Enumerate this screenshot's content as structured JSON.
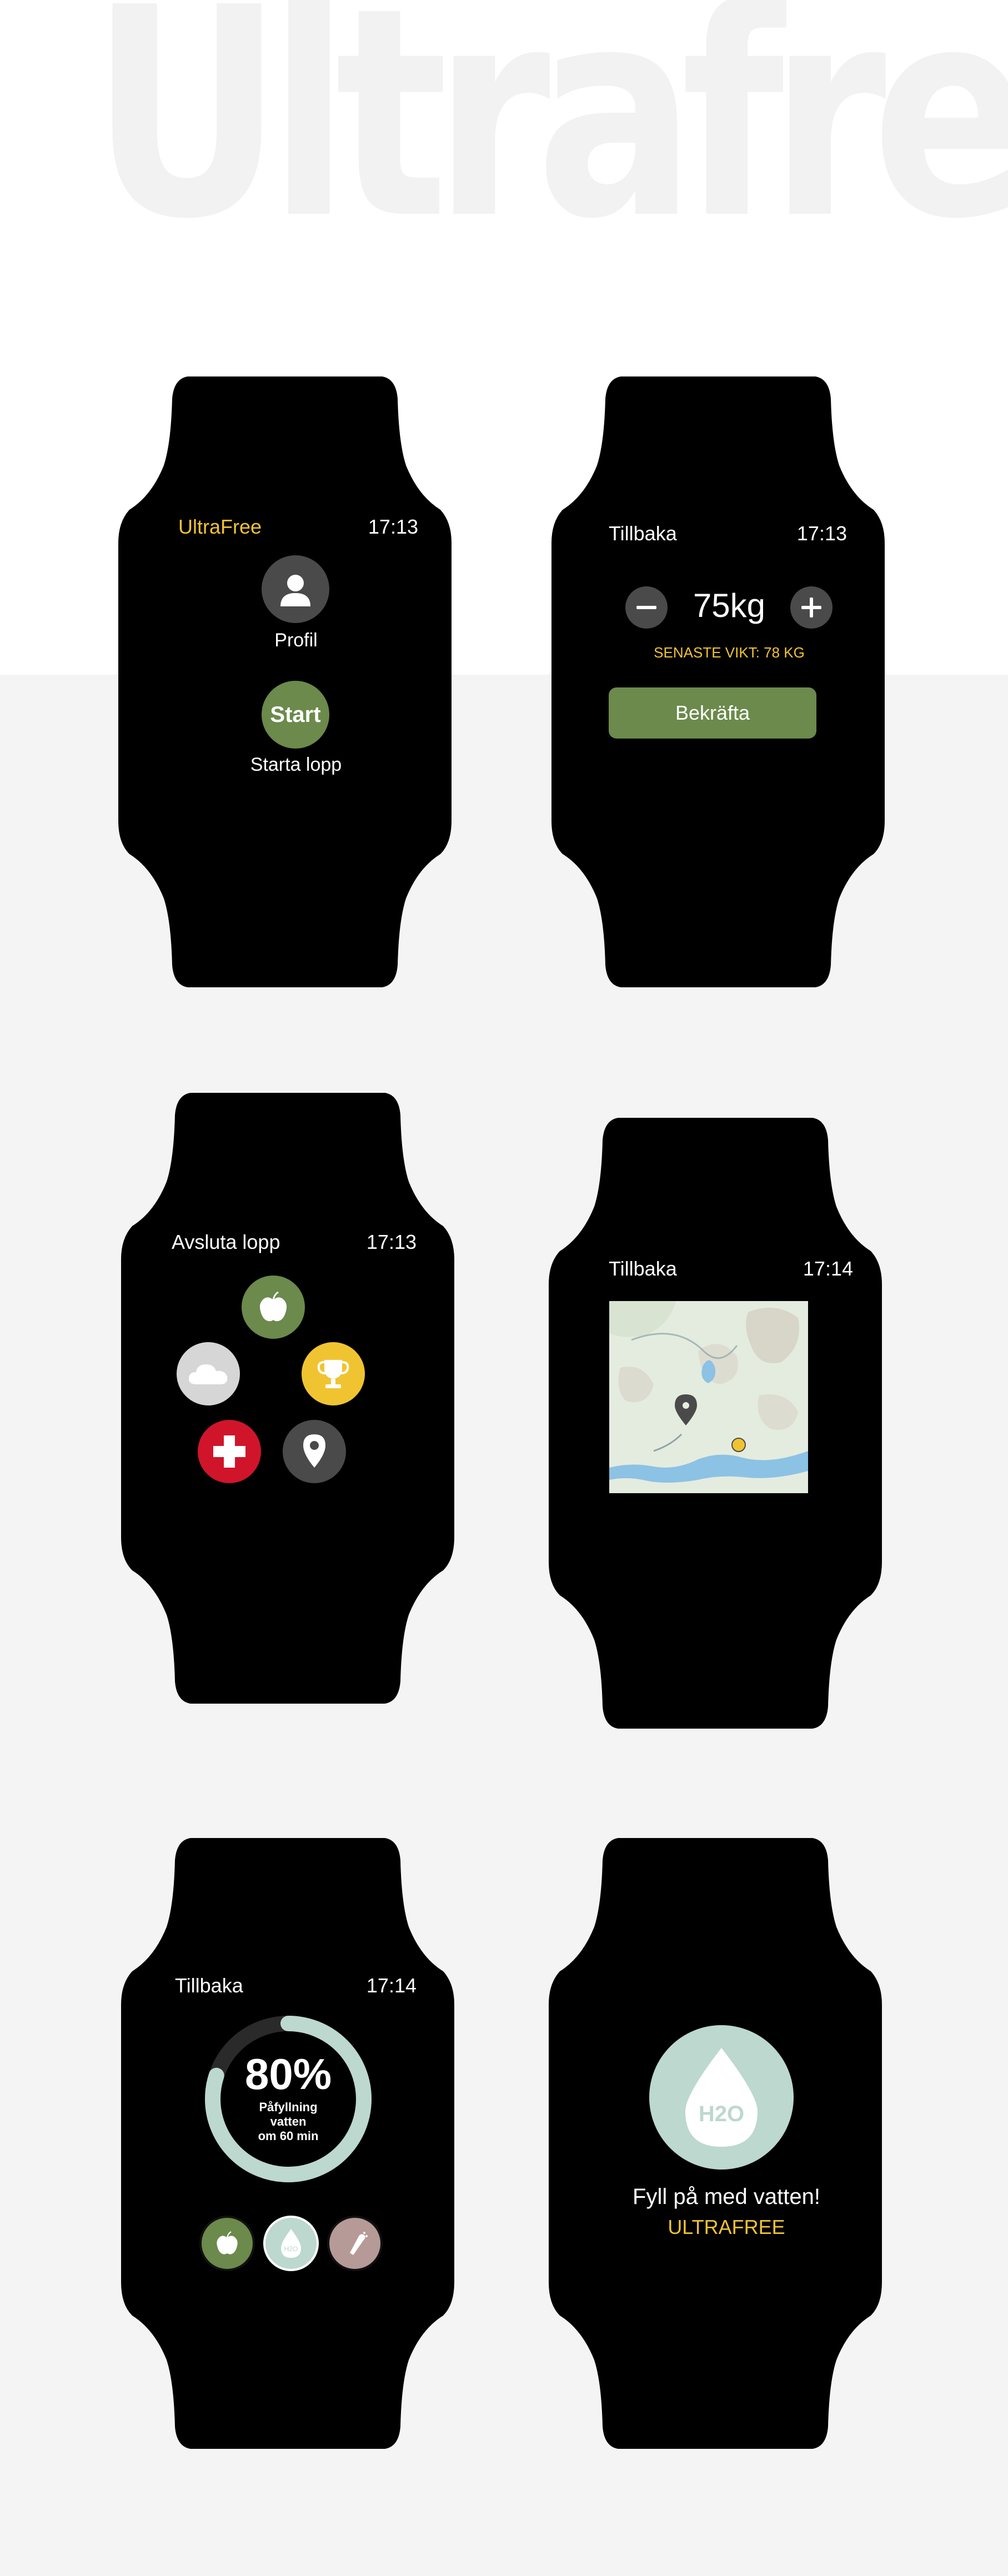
{
  "hero": {
    "title": "Ultrafree"
  },
  "screens": {
    "home": {
      "brand": "UltraFree",
      "time": "17:13",
      "profile_label": "Profil",
      "start_button": "Start",
      "start_label": "Starta lopp"
    },
    "weight": {
      "back": "Tillbaka",
      "time": "17:13",
      "value": "75kg",
      "last_weight": "SENASTE VIKT: 78 KG",
      "confirm": "Bekräfta"
    },
    "menu": {
      "end_run": "Avsluta lopp",
      "time": "17:13",
      "items": [
        "apple-icon",
        "cloud-icon",
        "trophy-icon",
        "first-aid-icon",
        "location-pin-icon"
      ]
    },
    "map": {
      "back": "Tillbaka",
      "time": "17:14"
    },
    "hydration": {
      "back": "Tillbaka",
      "time": "17:14",
      "percent": "80%",
      "line1": "Påfyllning",
      "line2": "vatten",
      "line3": "om 60 min",
      "progress": 0.8,
      "water_icon_text": "H2O"
    },
    "refill": {
      "message": "Fyll på med vatten!",
      "brand": "ULTRAFREE",
      "icon_text": "H2O"
    }
  },
  "colors": {
    "accent_yellow": "#f0c431",
    "green": "#6b8a4b",
    "water": "#bcd8cf",
    "red": "#d0152b",
    "dark_gray": "#4a4a4a",
    "salt": "#b59a97"
  }
}
